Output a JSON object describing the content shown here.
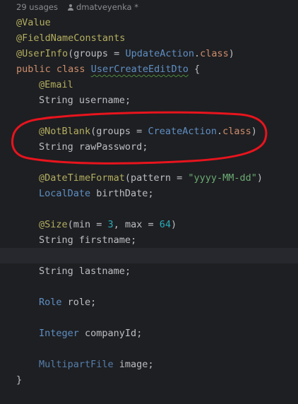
{
  "hint": {
    "usages": "29 usages",
    "author": "dmatveyenka *"
  },
  "lines": {
    "l1": {
      "a": "@Value"
    },
    "l2": {
      "a": "@FieldNameConstants"
    },
    "l3": {
      "a": "@UserInfo",
      "p1": "(groups = ",
      "c": "UpdateAction",
      "p2": ".",
      "k": "class",
      "p3": ")"
    },
    "l4": {
      "k1": "public ",
      "k2": "class ",
      "c": "UserCreateEditDto",
      "p": " {"
    },
    "l5": {
      "a": "@Email"
    },
    "l6": {
      "t": "String ",
      "n": "username",
      "p": ";"
    },
    "l7": {
      "a": "@NotBlank",
      "p1": "(groups = ",
      "c": "CreateAction",
      "p2": ".",
      "k": "class",
      "p3": ")"
    },
    "l8": {
      "t": "String ",
      "n": "rawPassword",
      "p": ";"
    },
    "l9": {
      "a": "@DateTimeFormat",
      "p1": "(pattern = ",
      "s": "\"yyyy-MM-dd\"",
      "p2": ")"
    },
    "l10": {
      "t": "LocalDate ",
      "n": "birthDate",
      "p": ";"
    },
    "l11": {
      "a": "@Size",
      "p1": "(min = ",
      "n1": "3",
      "p2": ", max = ",
      "n2": "64",
      "p3": ")"
    },
    "l12": {
      "t": "String ",
      "n": "firstname",
      "p": ";"
    },
    "l13": {
      "t": "String ",
      "n": "lastname",
      "p": ";"
    },
    "l14": {
      "t": "Role ",
      "n": "role",
      "p": ";"
    },
    "l15": {
      "t": "Integer ",
      "n": "companyId",
      "p": ";"
    },
    "l16": {
      "t": "MultipartFile ",
      "n": "image",
      "p": ";"
    },
    "l17": {
      "p": "}"
    }
  },
  "colors": {
    "background": "#1e1f22",
    "annotation": "#b3ae60",
    "keyword": "#cf8e6d",
    "class_ref": "#5f8fc4",
    "string": "#6aab73",
    "number": "#2aacb8",
    "text": "#bcbec4",
    "highlight_circle": "#e8141d"
  }
}
